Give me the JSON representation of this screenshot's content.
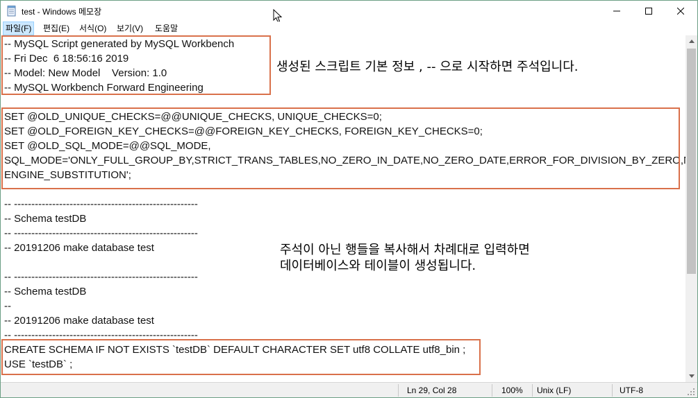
{
  "window": {
    "title": "test - Windows 메모장"
  },
  "menu": {
    "items": [
      "파일(F)",
      "편집(E)",
      "서식(O)",
      "보기(V)",
      "도움말"
    ]
  },
  "editor": {
    "lines": [
      "-- MySQL Script generated by MySQL Workbench",
      "-- Fri Dec  6 18:56:16 2019",
      "-- Model: New Model    Version: 1.0",
      "-- MySQL Workbench Forward Engineering",
      "",
      "SET @OLD_UNIQUE_CHECKS=@@UNIQUE_CHECKS, UNIQUE_CHECKS=0;",
      "SET @OLD_FOREIGN_KEY_CHECKS=@@FOREIGN_KEY_CHECKS, FOREIGN_KEY_CHECKS=0;",
      "SET @OLD_SQL_MODE=@@SQL_MODE,",
      "SQL_MODE='ONLY_FULL_GROUP_BY,STRICT_TRANS_TABLES,NO_ZERO_IN_DATE,NO_ZERO_DATE,ERROR_FOR_DIVISION_BY_ZERO,NO_",
      "ENGINE_SUBSTITUTION';",
      "",
      "-- -----------------------------------------------------",
      "-- Schema testDB",
      "-- -----------------------------------------------------",
      "-- 20191206 make database test",
      "",
      "-- -----------------------------------------------------",
      "-- Schema testDB",
      "--",
      "-- 20191206 make database test",
      "-- -----------------------------------------------------",
      "CREATE SCHEMA IF NOT EXISTS `testDB` DEFAULT CHARACTER SET utf8 COLLATE utf8_bin ;",
      "USE `testDB` ;"
    ]
  },
  "annotations": {
    "note1": "생성된 스크립트 기본 정보 , -- 으로 시작하면 주석입니다.",
    "note2_line1": "주석이 아닌 행들을 복사해서 차례대로 입력하면",
    "note2_line2": "데이터베이스와 테이블이 생성됩니다.",
    "box_color": "#d9704a"
  },
  "status": {
    "position": "Ln 29, Col 28",
    "zoom": "100%",
    "line_ending": "Unix (LF)",
    "encoding": "UTF-8"
  }
}
